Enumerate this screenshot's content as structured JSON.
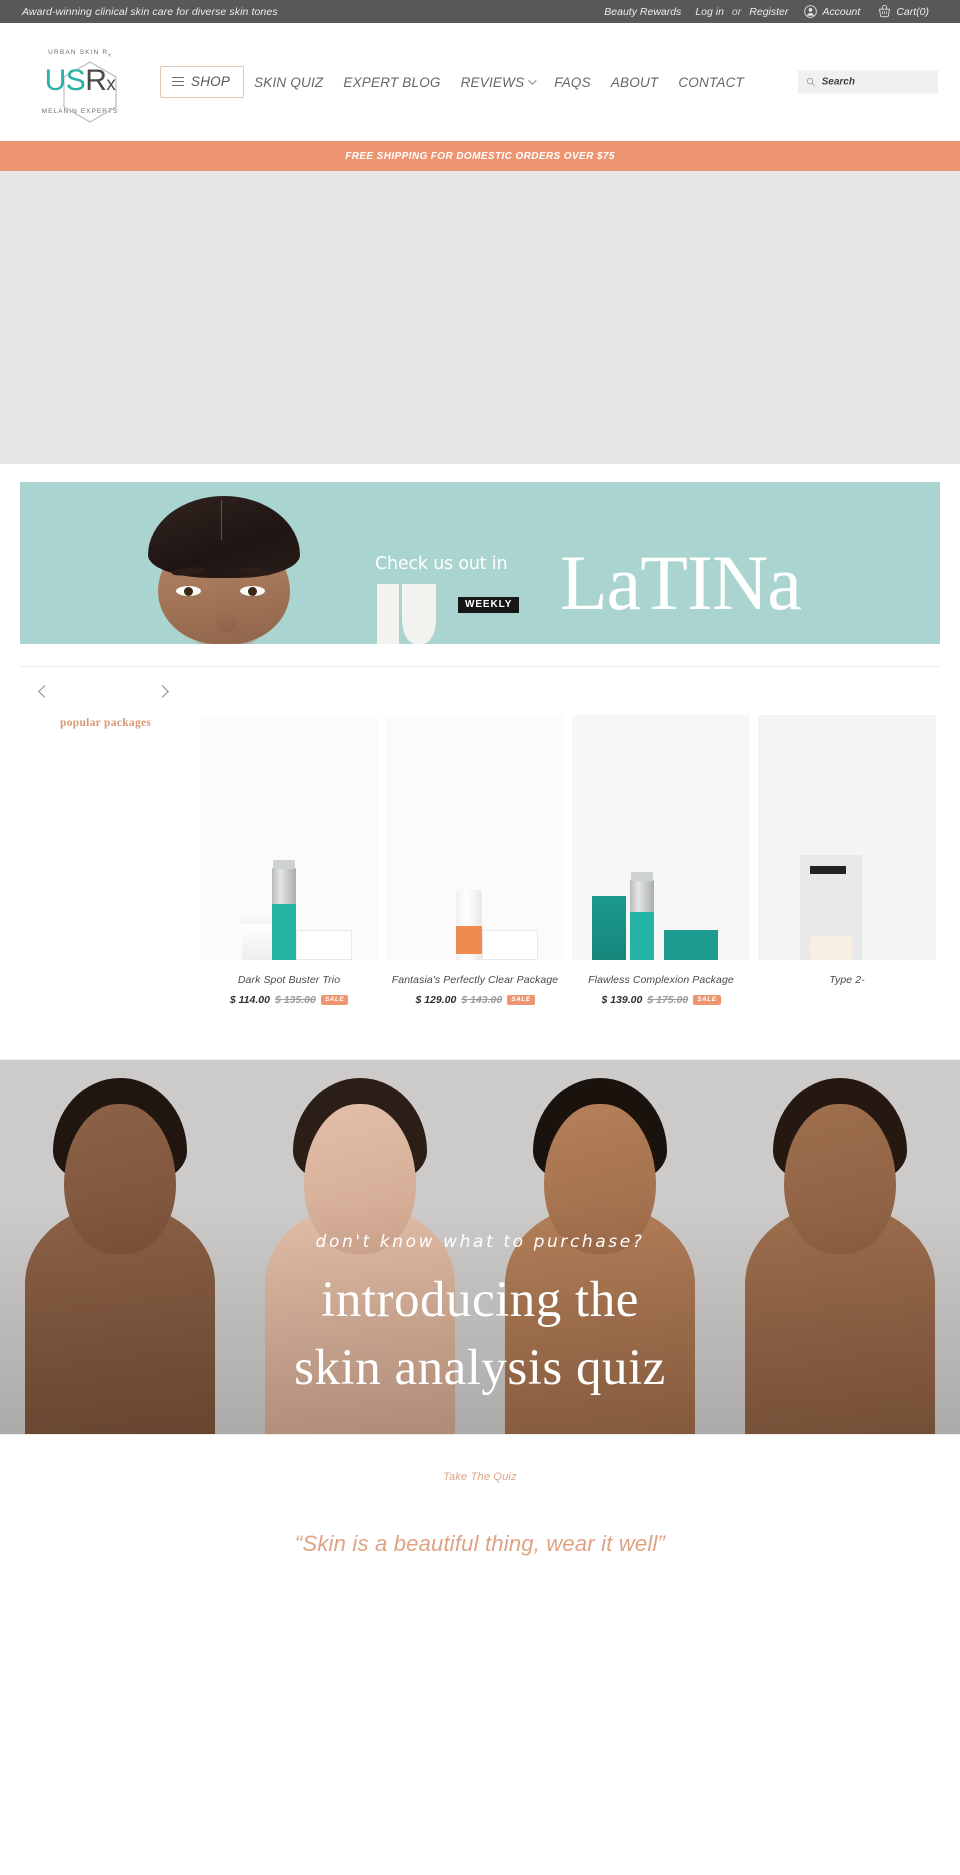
{
  "topbar": {
    "tagline": "Award-winning clinical skin care for diverse skin tones",
    "rewards": "Beauty Rewards",
    "login": "Log in",
    "or": "or",
    "register": "Register",
    "account": "Account",
    "cart": "Cart(0)"
  },
  "logo": {
    "top": "URBAN SKIN R",
    "top_sub": "x",
    "letters_us": "US",
    "letters_r": "R",
    "letters_x": "x",
    "bottom": "MELANIN EXPERTS"
  },
  "nav": {
    "shop": "SHOP",
    "items": [
      {
        "label": "SKIN QUIZ",
        "has_caret": false
      },
      {
        "label": "EXPERT BLOG",
        "has_caret": false
      },
      {
        "label": "REVIEWS",
        "has_caret": true
      },
      {
        "label": "FAQS",
        "has_caret": false
      },
      {
        "label": "ABOUT",
        "has_caret": false
      },
      {
        "label": "CONTACT",
        "has_caret": false
      }
    ]
  },
  "search": {
    "placeholder": "Search",
    "value": ""
  },
  "shipping_banner": {
    "text": "FREE SHIPPING FOR DOMESTIC ORDERS OVER $75",
    "color": "#ed9570"
  },
  "promo": {
    "kicker": "Check us out in",
    "weekly_badge": "WEEKLY",
    "brand": "LaTINa",
    "bg_color": "#aad4cf"
  },
  "carousel": {
    "label": "popular packages",
    "prev": "‹",
    "next": "›",
    "products": [
      {
        "title": "Dark Spot Buster Trio",
        "price": "$ 114.00",
        "compare_at": "$ 135.00",
        "badge": "SALE"
      },
      {
        "title": "Fantasia's Perfectly Clear Package",
        "price": "$ 129.00",
        "compare_at": "$ 143.00",
        "badge": "SALE"
      },
      {
        "title": "Flawless Complexion Package",
        "price": "$ 139.00",
        "compare_at": "$ 175.00",
        "badge": "SALE"
      },
      {
        "title": "Type 2-",
        "price": "",
        "compare_at": "",
        "badge": ""
      }
    ]
  },
  "quiz_hero": {
    "kicker": "don't know what to purchase?",
    "line1": "introducing the",
    "line2": "skin analysis quiz"
  },
  "footer_cta": {
    "take_quiz": "Take The Quiz",
    "quote": "“Skin is a beautiful thing, wear it well”",
    "accent_color": "#dfa283"
  }
}
